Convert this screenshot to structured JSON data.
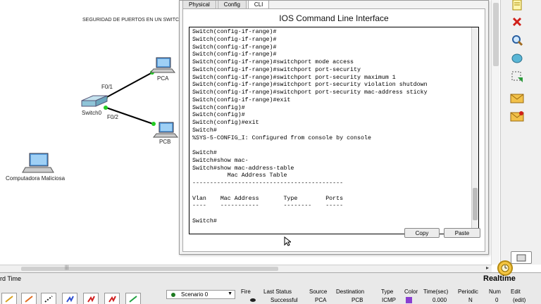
{
  "workspace": {
    "title": "SEGURIDAD DE PUERTOS EN UN SWITCH",
    "devices": {
      "pca": "PCA",
      "pcb": "PCB",
      "switch": "Switch0",
      "malicious": "Computadora Maliciosa"
    },
    "ports": {
      "f01": "F0/1",
      "f02": "F0/2"
    }
  },
  "cli_window": {
    "tabs": [
      "Physical",
      "Config",
      "CLI"
    ],
    "active_tab": "CLI",
    "title": "IOS Command Line Interface",
    "terminal_lines": [
      "Switch(config-if-range)#",
      "Switch(config-if-range)#",
      "Switch(config-if-range)#",
      "Switch(config-if-range)#",
      "Switch(config-if-range)#switchport mode access",
      "Switch(config-if-range)#switchport port-security",
      "Switch(config-if-range)#switchport port-security maximum 1",
      "Switch(config-if-range)#switchport port-security violation shutdown",
      "Switch(config-if-range)#switchport port-security mac-address sticky",
      "Switch(config-if-range)#exit",
      "Switch(config)#",
      "Switch(config)#",
      "Switch(config)#exit",
      "Switch#",
      "%SYS-5-CONFIG_I: Configured from console by console",
      "",
      "Switch#",
      "Switch#show mac-",
      "Switch#show mac-address-table",
      "          Mac Address Table",
      "-------------------------------------------",
      "",
      "Vlan    Mac Address       Type        Ports",
      "----    -----------       --------    -----",
      "",
      "Switch#"
    ],
    "copy_label": "Copy",
    "paste_label": "Paste"
  },
  "bottom": {
    "time_label": "rd Time",
    "realtime_label": "Realtime",
    "scenario": "Scenario 0",
    "pdu_headers": {
      "fire": "Fire",
      "last_status": "Last Status",
      "source": "Source",
      "destination": "Destination",
      "type": "Type",
      "color": "Color",
      "time": "Time(sec)",
      "periodic": "Periodic",
      "num": "Num",
      "edit": "Edit"
    },
    "pdu_row": {
      "last_status": "Successful",
      "source": "PCA",
      "destination": "PCB",
      "type": "ICMP",
      "color": "#8a3fd1",
      "time": "0.000",
      "periodic": "N",
      "num": "0",
      "edit": "(edit)"
    }
  },
  "colors": {
    "link_up": "#22cc22",
    "pc_screen": "#5aa0e0",
    "switch_body": "#8fc4d8"
  }
}
